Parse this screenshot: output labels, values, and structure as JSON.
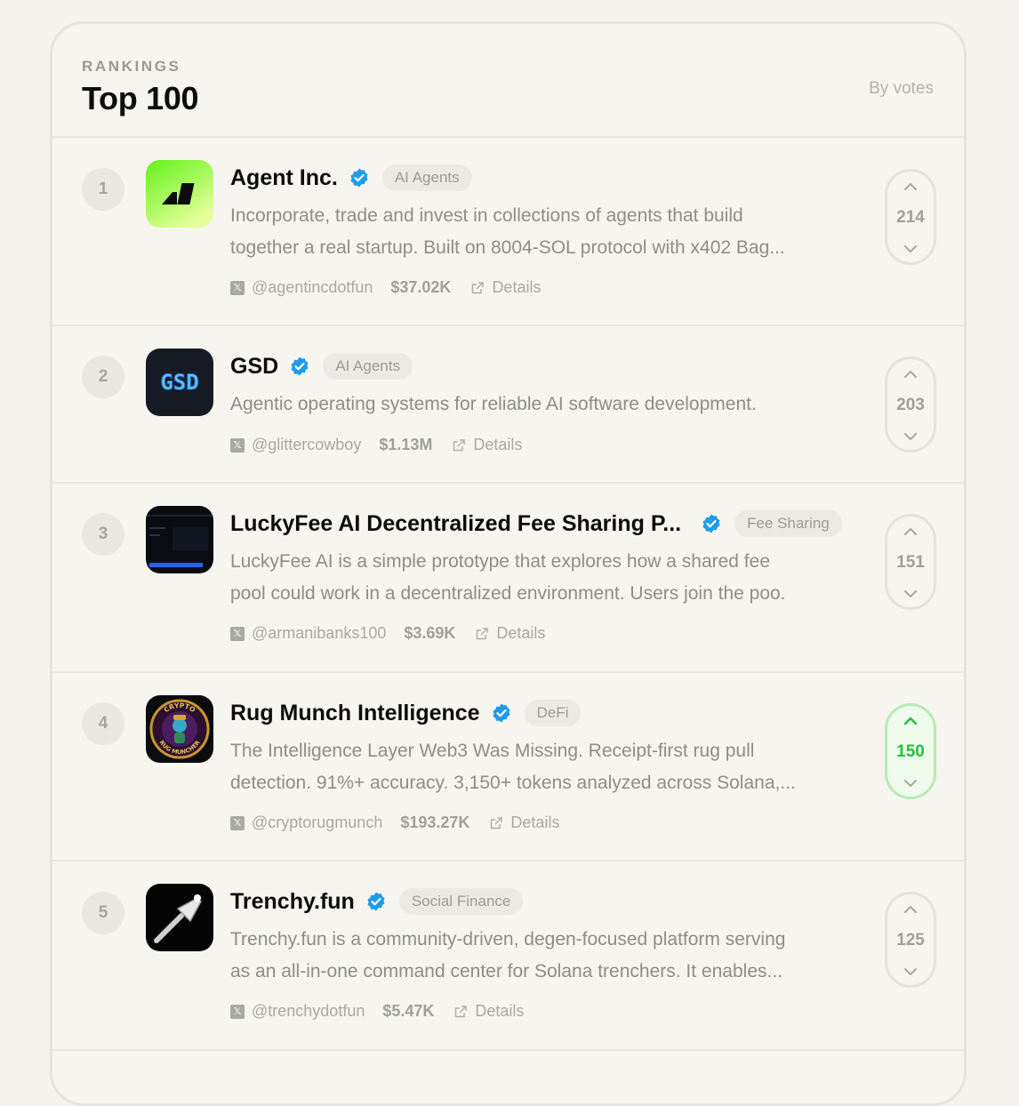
{
  "header": {
    "eyebrow": "RANKINGS",
    "title": "Top 100",
    "sort_label": "By votes"
  },
  "colors": {
    "verified": "#1d9bf0",
    "vote_active": "#22c23a",
    "background": "#f4f3ec"
  },
  "projects": [
    {
      "rank": "1",
      "name": "Agent Inc.",
      "tag": "AI Agents",
      "desc_line1": "Incorporate, trade and invest in collections of agents that build",
      "desc_line2": "together a real startup. Built on 8004-SOL protocol with x402 Bag...",
      "handle": "@agentincdotfun",
      "mcap": "$37.02K",
      "details": "Details",
      "votes": "214",
      "logo_icon": "agent-inc-logo"
    },
    {
      "rank": "2",
      "name": "GSD",
      "tag": "AI Agents",
      "desc_line1": "Agentic operating systems for reliable AI software development.",
      "handle": "@glittercowboy",
      "mcap": "$1.13M",
      "details": "Details",
      "votes": "203",
      "logo_text": "GSD"
    },
    {
      "rank": "3",
      "name": "LuckyFee AI Decentralized Fee Sharing P...",
      "tag": "Fee Sharing",
      "desc_line1": "LuckyFee AI is a simple prototype that explores how a shared fee",
      "desc_line2": "pool could work in a decentralized environment.  Users join the poo.",
      "handle": "@armanibanks100",
      "mcap": "$3.69K",
      "details": "Details",
      "votes": "151",
      "logo_icon": "luckyfee-logo"
    },
    {
      "rank": "4",
      "name": "Rug Munch Intelligence",
      "tag": "DeFi",
      "desc_line1": "The Intelligence Layer Web3 Was Missing.  Receipt-first rug pull",
      "desc_line2": "detection. 91%+ accuracy. 3,150+ tokens analyzed across Solana,...",
      "handle": "@cryptorugmunch",
      "mcap": "$193.27K",
      "details": "Details",
      "votes": "150",
      "voted": true,
      "logo_text_top": "CRYPTO",
      "logo_text_bottom": "RUG MUNCHER"
    },
    {
      "rank": "5",
      "name": "Trenchy.fun",
      "tag": "Social Finance",
      "desc_line1": "Trenchy.fun is a community-driven, degen-focused platform serving",
      "desc_line2": "as an all-in-one command center for Solana trenchers. It enables...",
      "handle": "@trenchydotfun",
      "mcap": "$5.47K",
      "details": "Details",
      "votes": "125",
      "logo_icon": "shovel-logo"
    }
  ]
}
